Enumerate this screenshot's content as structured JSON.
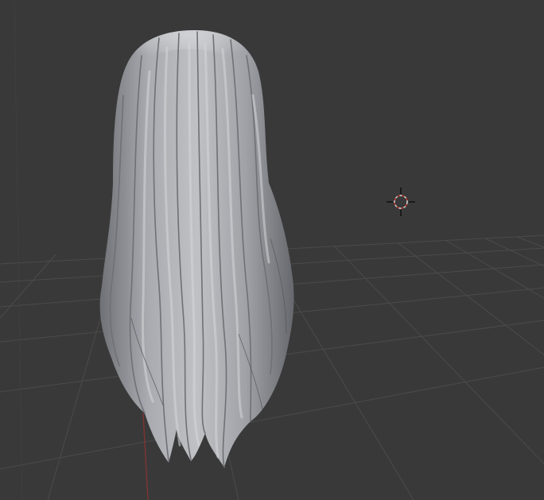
{
  "viewport": {
    "background_color": "#393939",
    "grid_line_color": "#4a4a4a",
    "grid_axis_x_color": "#8b3a3a",
    "grid_axis_y_color": "#7f9f3f"
  },
  "mesh": {
    "object_name": "",
    "base_color": "#9fa1a6",
    "highlight_color": "#d7d9dd",
    "shadow_color": "#55575c"
  },
  "cursor_3d": {
    "icon": "3d-cursor-icon",
    "ring_colors": [
      "#d8d8d8",
      "#c0392b"
    ]
  }
}
